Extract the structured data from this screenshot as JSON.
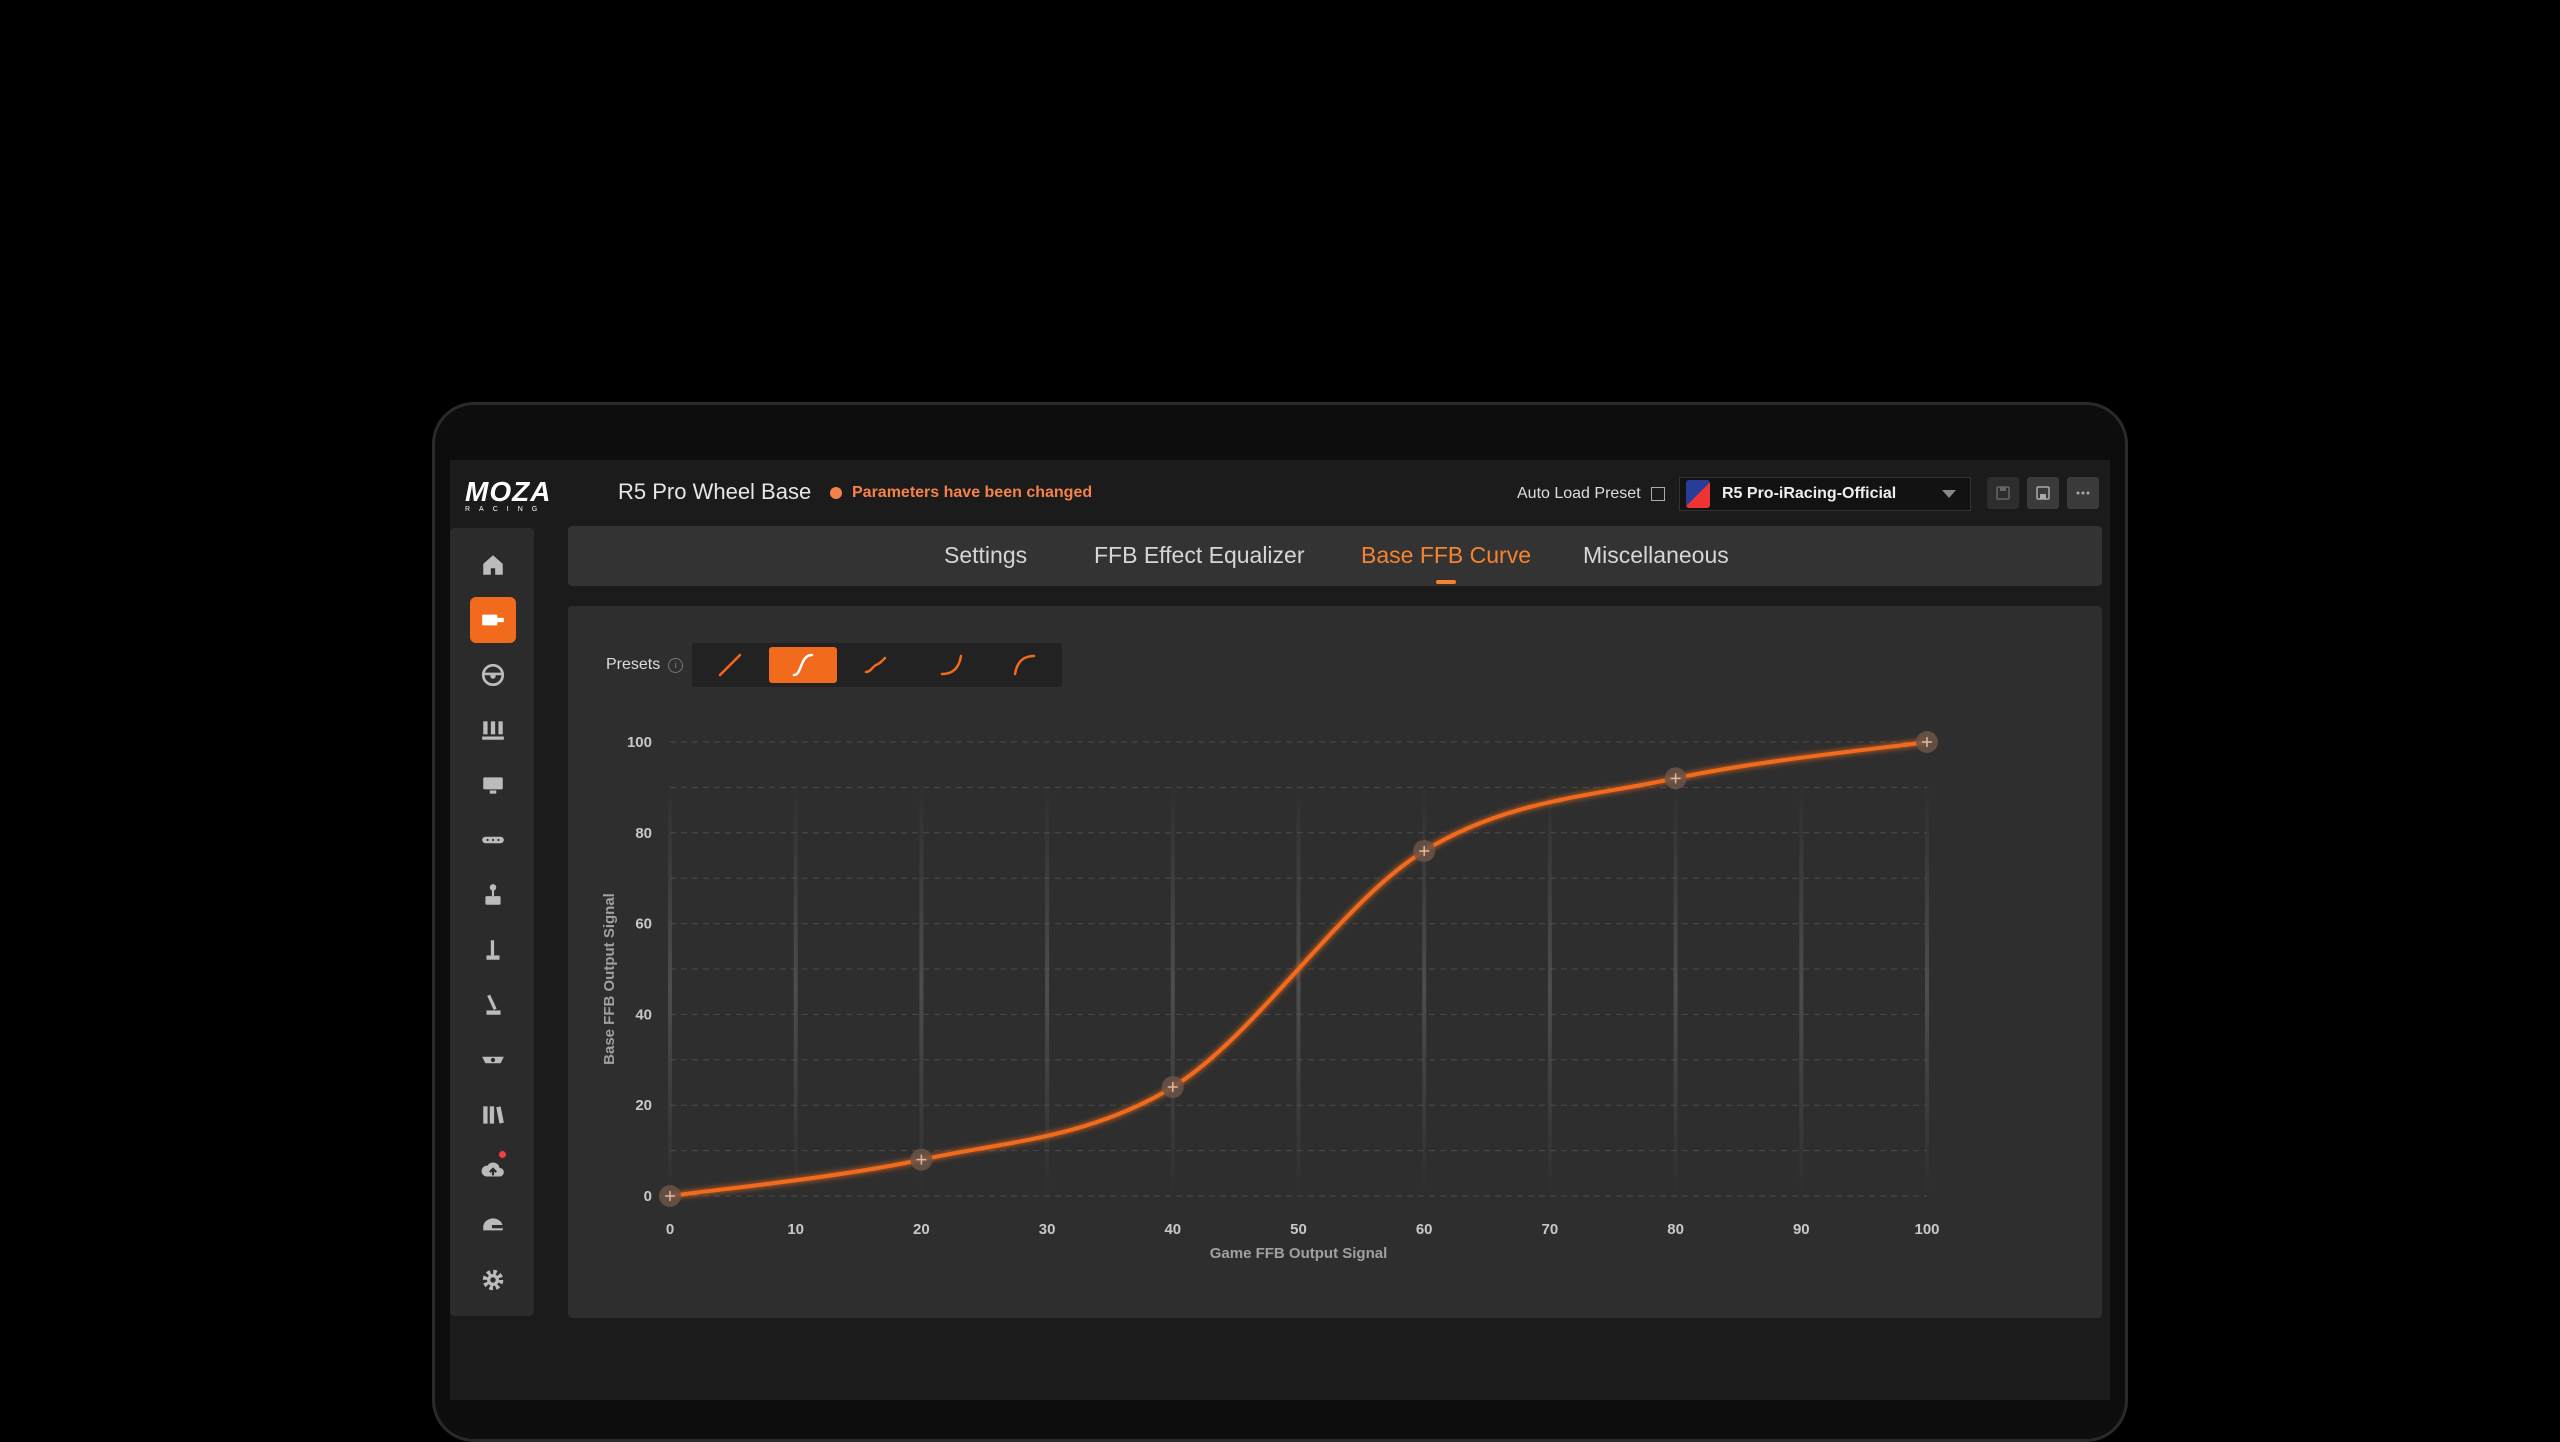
{
  "app": {
    "logo_main": "MOZA",
    "logo_sub": "RACING",
    "device_title": "R5 Pro Wheel Base",
    "status_text": "Parameters have been changed",
    "auto_load_label": "Auto Load Preset",
    "preset_name": "R5 Pro-iRacing-Official",
    "accent_color": "#f26a1c"
  },
  "sidebar": {
    "items": [
      {
        "name": "home-icon"
      },
      {
        "name": "wheelbase-icon",
        "active": true
      },
      {
        "name": "steering-wheel-icon"
      },
      {
        "name": "pedals-icon"
      },
      {
        "name": "dashboard-icon"
      },
      {
        "name": "button-box-icon"
      },
      {
        "name": "handbrake-icon"
      },
      {
        "name": "shifter-icon"
      },
      {
        "name": "sequential-shifter-icon"
      },
      {
        "name": "hub-icon"
      },
      {
        "name": "library-icon"
      },
      {
        "name": "cloud-upload-icon",
        "badge": true
      },
      {
        "name": "helmet-icon"
      },
      {
        "name": "settings-gear-icon"
      }
    ]
  },
  "tabs": [
    {
      "label": "Settings"
    },
    {
      "label": "FFB Effect Equalizer"
    },
    {
      "label": "Base FFB Curve",
      "active": true
    },
    {
      "label": "Miscellaneous"
    }
  ],
  "presets": {
    "label": "Presets",
    "items": [
      {
        "name": "linear-preset-icon"
      },
      {
        "name": "s-curve-preset-icon",
        "active": true
      },
      {
        "name": "wave-preset-icon"
      },
      {
        "name": "convex-preset-icon"
      },
      {
        "name": "concave-preset-icon"
      }
    ]
  },
  "chart_data": {
    "type": "line",
    "xlabel": "Game FFB Output Signal",
    "ylabel": "Base FFB Output Signal",
    "xlim": [
      0,
      100
    ],
    "ylim": [
      0,
      100
    ],
    "x_ticks": [
      0,
      10,
      20,
      30,
      40,
      50,
      60,
      70,
      80,
      90,
      100
    ],
    "y_ticks": [
      0,
      20,
      40,
      60,
      80,
      100
    ],
    "grid": true,
    "series": [
      {
        "color": "#f26a1c",
        "points": [
          [
            0,
            0
          ],
          [
            20,
            8
          ],
          [
            40,
            24
          ],
          [
            60,
            76
          ],
          [
            80,
            92
          ],
          [
            100,
            100
          ]
        ]
      }
    ]
  }
}
